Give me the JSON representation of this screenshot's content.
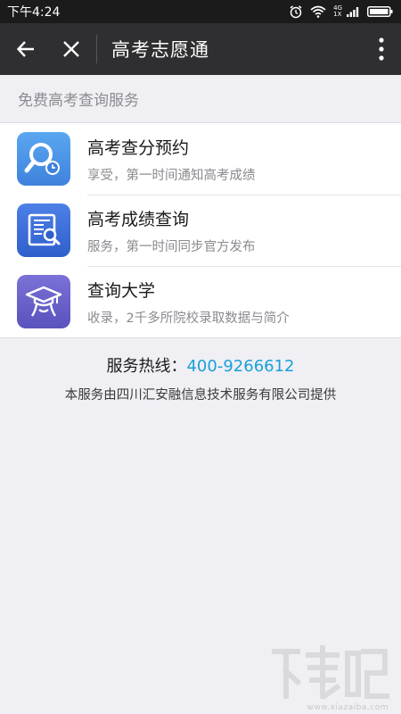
{
  "status_bar": {
    "time": "下午4:24",
    "network_top": "4G",
    "network_bottom": "1X"
  },
  "nav": {
    "title": "高考志愿通"
  },
  "section": {
    "header": "免费高考查询服务"
  },
  "services": [
    {
      "title": "高考查分预约",
      "subtitle": "享受，第一时间通知高考成绩",
      "icon": "search-clock-icon",
      "color": "#4a90e2"
    },
    {
      "title": "高考成绩查询",
      "subtitle": "服务，第一时间同步官方发布",
      "icon": "score-report-icon",
      "color": "#3d6fd6"
    },
    {
      "title": "查询大学",
      "subtitle": "收录，2千多所院校录取数据与简介",
      "icon": "graduate-cap-icon",
      "color": "#6b63c9"
    }
  ],
  "footer": {
    "hotline_label": "服务热线：",
    "hotline_number": "400-9266612",
    "provider": "本服务由四川汇安融信息技术服务有限公司提供"
  },
  "watermark": {
    "url": "www.xiazaiba.com"
  },
  "colors": {
    "nav_bg": "#2f2f31",
    "status_bg": "#1b1b1b",
    "page_bg": "#efeff4",
    "link": "#1aa0d8"
  }
}
